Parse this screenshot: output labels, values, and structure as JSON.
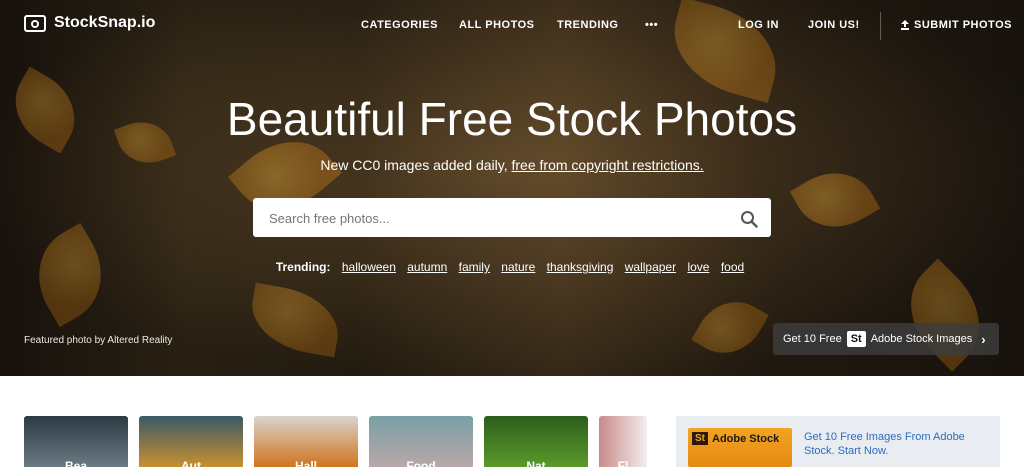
{
  "logo": {
    "name": "StockSnap.io"
  },
  "nav": {
    "categories": "CATEGORIES",
    "all_photos": "ALL PHOTOS",
    "trending": "TRENDING",
    "more": "•••",
    "login": "LOG IN",
    "join": "JOIN US!",
    "submit": "SUBMIT PHOTOS"
  },
  "hero": {
    "title": "Beautiful Free Stock Photos",
    "subtitle_prefix": "New CC0 images added daily,",
    "subtitle_link": "free from copyright restrictions.",
    "search_placeholder": "Search free photos...",
    "trending_label": "Trending:",
    "trending_tags": [
      "halloween",
      "autumn",
      "family",
      "nature",
      "thanksgiving",
      "wallpaper",
      "love",
      "food"
    ],
    "featured_prefix": "Featured photo by",
    "featured_author": "Altered Reality",
    "adobe_prefix": "Get 10 Free",
    "adobe_badge": "St",
    "adobe_suffix": "Adobe Stock Images",
    "adobe_arrow": "›"
  },
  "categories": [
    {
      "label": "Bea"
    },
    {
      "label": "Aut"
    },
    {
      "label": "Hall"
    },
    {
      "label": "Food"
    },
    {
      "label": "Nat"
    },
    {
      "label": "Fl"
    }
  ],
  "ad": {
    "badge": "St",
    "brand": "Adobe Stock",
    "text": "Get 10 Free Images From Adobe Stock. Start Now."
  }
}
